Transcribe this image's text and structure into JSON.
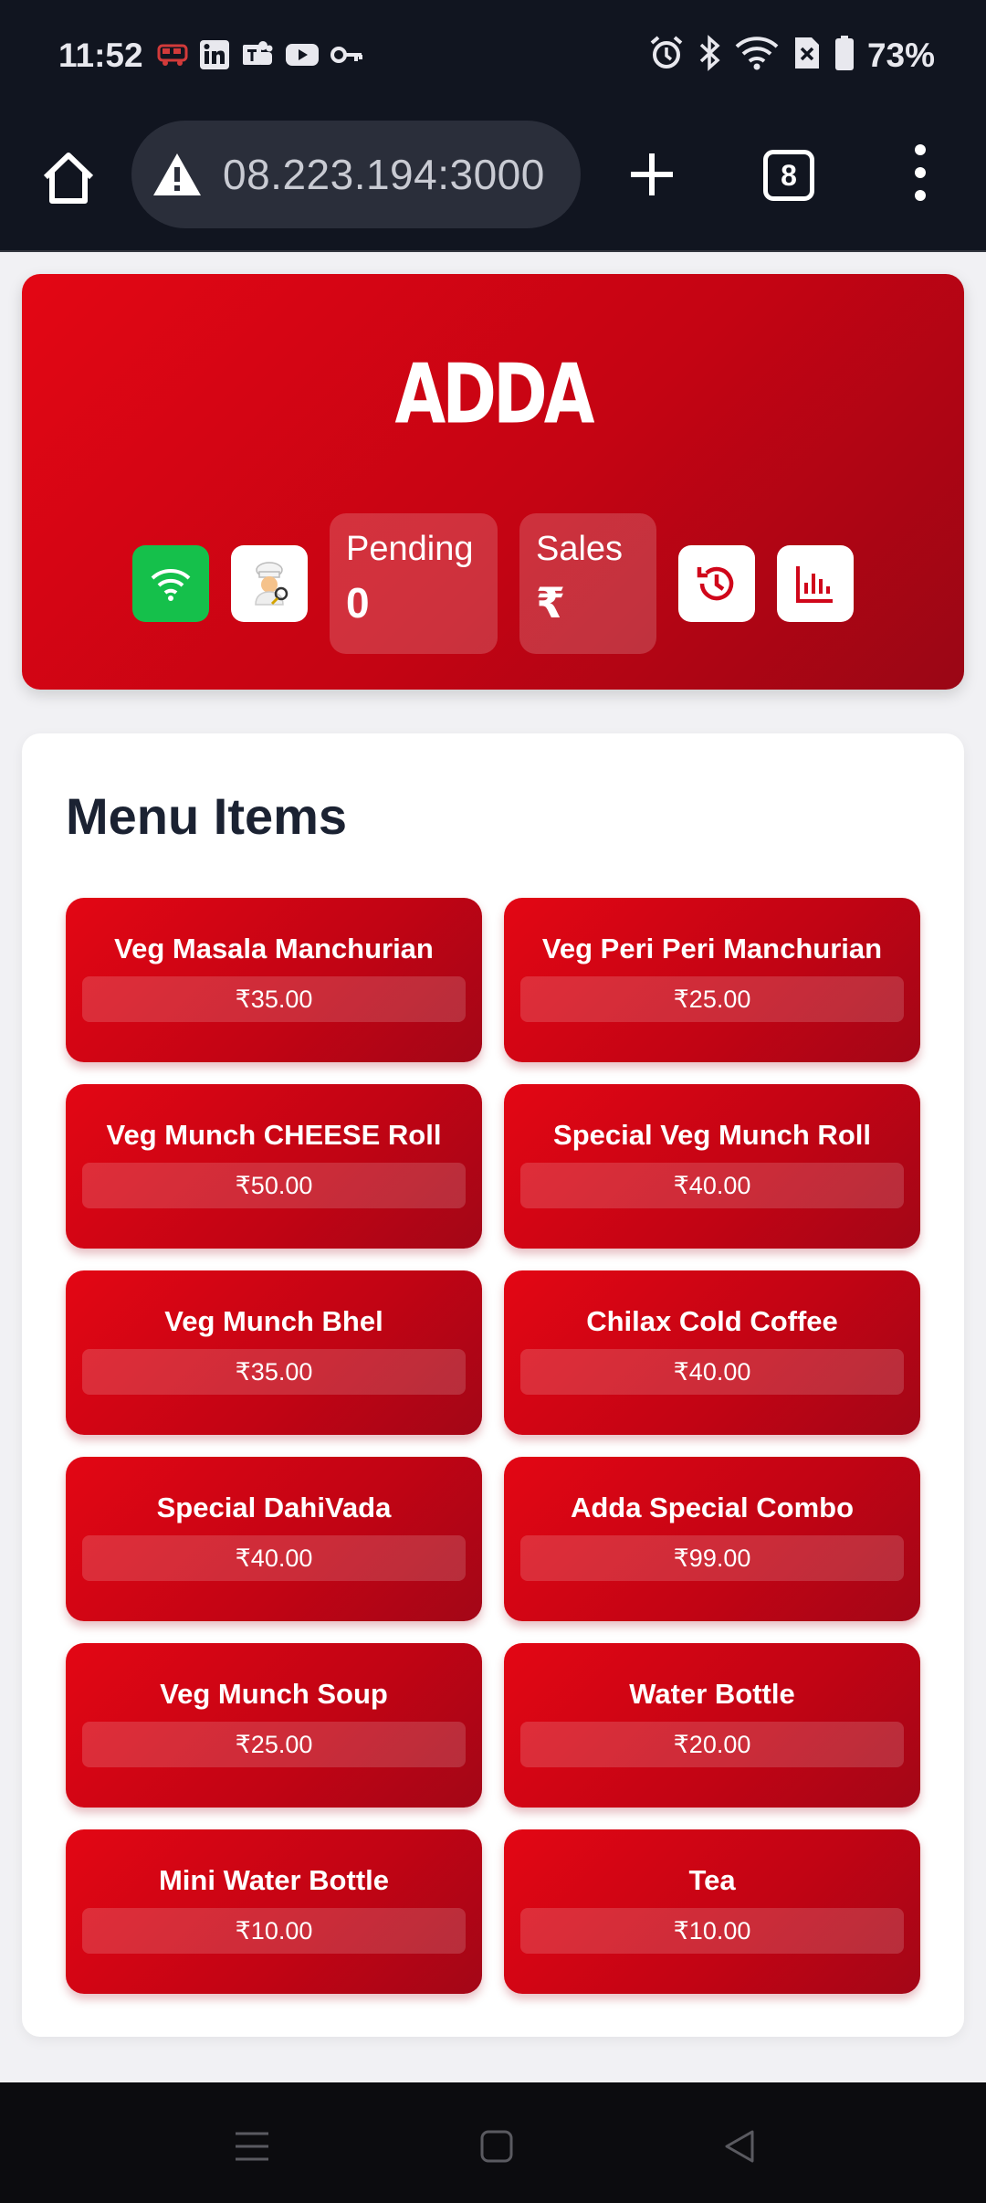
{
  "status_bar": {
    "time": "11:52",
    "battery": "73%",
    "notification_icons": [
      "bus-icon",
      "linkedin-icon",
      "teams-icon",
      "youtube-icon",
      "key-icon"
    ],
    "system_icons": [
      "alarm-icon",
      "bluetooth-icon",
      "wifi-icon",
      "no-sim-icon",
      "battery-icon"
    ]
  },
  "browser": {
    "url": "08.223.194:3000",
    "tab_count": "8",
    "security": "warning-icon"
  },
  "header": {
    "logo_text": "ADDA",
    "pending_label": "Pending",
    "pending_value": "0",
    "sales_label": "Sales",
    "sales_value": "₹",
    "buttons": [
      "wifi-icon",
      "chef-icon",
      "history-icon",
      "bar-chart-icon"
    ]
  },
  "menu": {
    "title": "Menu Items",
    "items": [
      {
        "name": "Veg Masala Manchurian",
        "price": "₹35.00"
      },
      {
        "name": "Veg Peri Peri Manchurian",
        "price": "₹25.00"
      },
      {
        "name": "Veg Munch CHEESE Roll",
        "price": "₹50.00"
      },
      {
        "name": "Special Veg Munch Roll",
        "price": "₹40.00"
      },
      {
        "name": "Veg Munch Bhel",
        "price": "₹35.00"
      },
      {
        "name": "Chilax Cold Coffee",
        "price": "₹40.00"
      },
      {
        "name": "Special DahiVada",
        "price": "₹40.00"
      },
      {
        "name": "Adda Special Combo",
        "price": "₹99.00"
      },
      {
        "name": "Veg Munch Soup",
        "price": "₹25.00"
      },
      {
        "name": "Water Bottle",
        "price": "₹20.00"
      },
      {
        "name": "Mini Water Bottle",
        "price": "₹10.00"
      },
      {
        "name": "Tea",
        "price": "₹10.00"
      }
    ]
  },
  "colors": {
    "brand_red": "#e30614",
    "dark_red": "#9a0615",
    "wifi_green": "#15c04b",
    "title_dark": "#1b2232",
    "page_bg": "#f1f1f4"
  }
}
